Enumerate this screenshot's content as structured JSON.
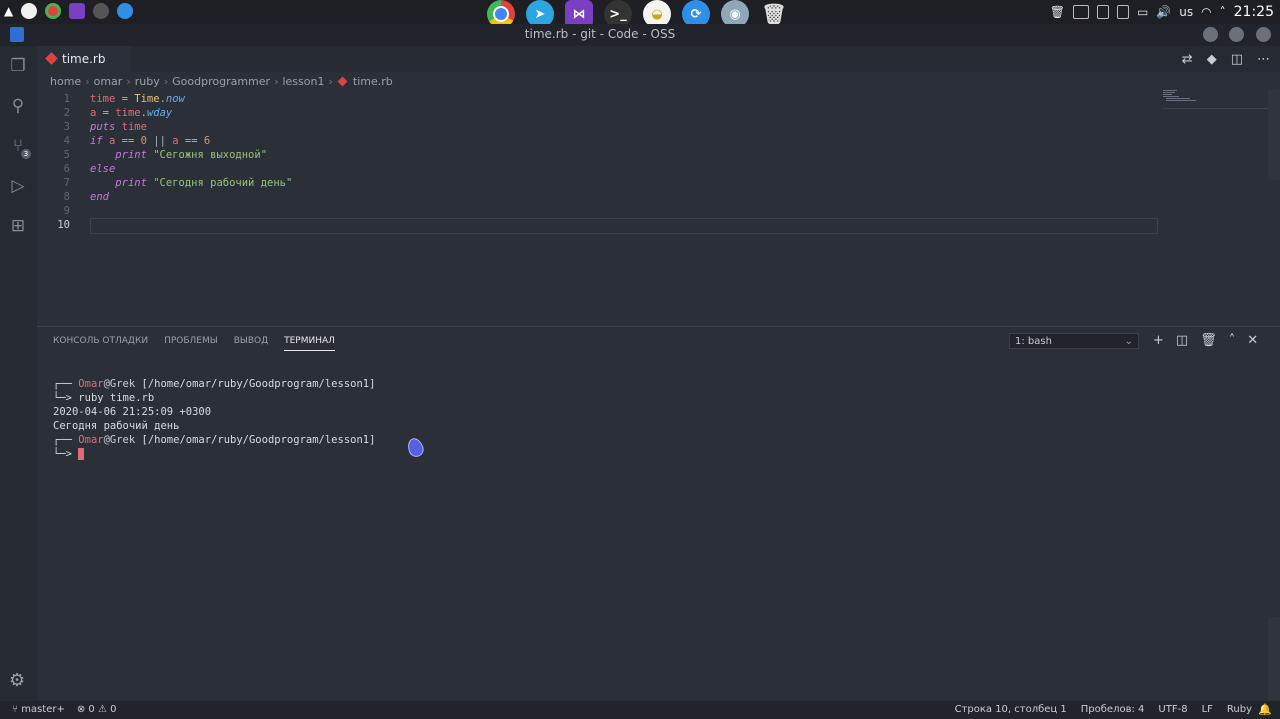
{
  "system": {
    "keyboard_layout": "us",
    "clock": "21:25",
    "dock_icons": [
      "chrome-icon",
      "telegram-icon",
      "vscode-icon",
      "terminal-icon",
      "notes-icon",
      "share-icon",
      "settings-icon",
      "trash-icon"
    ]
  },
  "window": {
    "title": "time.rb - git - Code - OSS"
  },
  "tab": {
    "label": "time.rb"
  },
  "breadcrumb": [
    "home",
    "omar",
    "ruby",
    "Goodprogrammer",
    "lesson1",
    "time.rb"
  ],
  "editor": {
    "line_numbers": [
      "1",
      "2",
      "3",
      "4",
      "5",
      "6",
      "7",
      "8",
      "9",
      "10"
    ]
  },
  "panel": {
    "tabs": [
      "КОНСОЛЬ ОТЛАДКИ",
      "ПРОБЛЕМЫ",
      "ВЫВОД",
      "ТЕРМИНАЛ"
    ],
    "active_tab": "ТЕРМИНАЛ",
    "terminal_select": "1: bash"
  },
  "terminal": {
    "user": "Omar",
    "host": "@Grek",
    "path": " [/home/omar/ruby/Goodprogram/lesson1]",
    "command": "ruby time.rb",
    "output": [
      "2020-04-06 21:25:09 +0300",
      "Сегодня рабочий день"
    ]
  },
  "status": {
    "branch": "master+",
    "errors": "0",
    "warnings": "0",
    "position": "Строка 10, столбец 1",
    "spaces": "Пробелов: 4",
    "encoding": "UTF-8",
    "eol": "LF",
    "language": "Ruby"
  }
}
